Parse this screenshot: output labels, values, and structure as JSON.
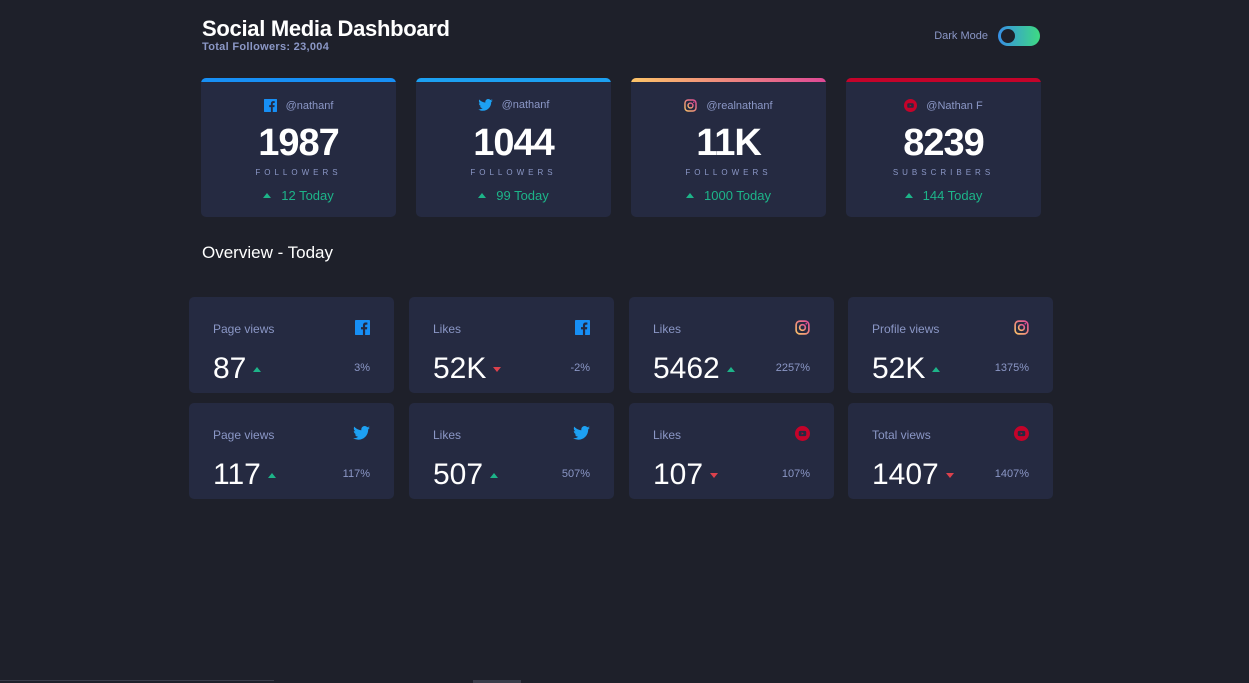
{
  "header": {
    "title": "Social Media Dashboard",
    "subtitle": "Total Followers: 23,004",
    "dark_mode_label": "Dark Mode"
  },
  "colors": {
    "facebook": "#178ff5",
    "twitter": "#1da0f2",
    "instagram_a": "#fdc468",
    "instagram_b": "#df4996",
    "youtube": "#c4032a",
    "up": "#1db489",
    "down": "#dc414c"
  },
  "summary_cards": [
    {
      "network": "facebook",
      "icon": "facebook-icon",
      "handle": "@nathanf",
      "count": "1987",
      "label": "FOLLOWERS",
      "today": "12 Today"
    },
    {
      "network": "twitter",
      "icon": "twitter-icon",
      "handle": "@nathanf",
      "count": "1044",
      "label": "FOLLOWERS",
      "today": "99 Today"
    },
    {
      "network": "instagram",
      "icon": "instagram-icon",
      "handle": "@realnathanf",
      "count": "11K",
      "label": "FOLLOWERS",
      "today": "1000 Today"
    },
    {
      "network": "youtube",
      "icon": "youtube-icon",
      "handle": "@Nathan F",
      "count": "8239",
      "label": "SUBSCRIBERS",
      "today": "144 Today"
    }
  ],
  "overview": {
    "title": "Overview - Today",
    "cards": [
      {
        "label": "Page views",
        "icon": "facebook-icon",
        "value": "87",
        "trend": "up",
        "pct": "3%"
      },
      {
        "label": "Likes",
        "icon": "facebook-icon",
        "value": "52K",
        "trend": "down",
        "pct": "-2%"
      },
      {
        "label": "Likes",
        "icon": "instagram-icon",
        "value": "5462",
        "trend": "up",
        "pct": "2257%"
      },
      {
        "label": "Profile views",
        "icon": "instagram-icon",
        "value": "52K",
        "trend": "up",
        "pct": "1375%"
      },
      {
        "label": "Page views",
        "icon": "twitter-icon",
        "value": "117",
        "trend": "up",
        "pct": "117%"
      },
      {
        "label": "Likes",
        "icon": "twitter-icon",
        "value": "507",
        "trend": "up",
        "pct": "507%"
      },
      {
        "label": "Likes",
        "icon": "youtube-icon",
        "value": "107",
        "trend": "down",
        "pct": "107%"
      },
      {
        "label": "Total views",
        "icon": "youtube-icon",
        "value": "1407",
        "trend": "down",
        "pct": "1407%"
      }
    ]
  }
}
